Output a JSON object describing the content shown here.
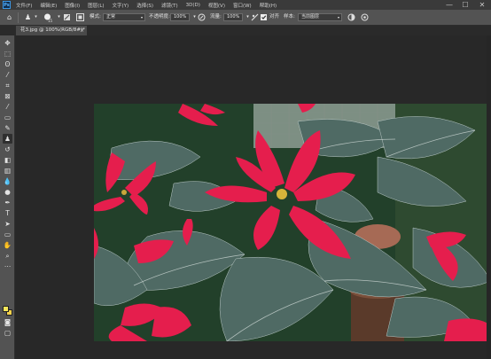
{
  "menubar": {
    "logo": "Ps",
    "items": [
      "文件(F)",
      "编辑(E)",
      "图像(I)",
      "图层(L)",
      "文字(Y)",
      "选择(S)",
      "滤镜(T)",
      "3D(D)",
      "视图(V)",
      "窗口(W)",
      "帮助(H)"
    ],
    "minimize": "—",
    "maximize": "☐",
    "close": "✕"
  },
  "options": {
    "brush_size": "15",
    "mode_label": "模式:",
    "mode_value": "正常",
    "opacity_label": "不透明度:",
    "opacity_value": "100%",
    "flow_label": "流量:",
    "flow_value": "100%",
    "aligned_label": "对齐",
    "sample_label": "样本:",
    "sample_value": "当前图层"
  },
  "document": {
    "tab_title": "花3.jpg @ 100%(RGB/8#)",
    "tab_modified": "*",
    "tab_close": "×"
  },
  "colors": {
    "foreground": "#f7e65a",
    "background": "#f3d24c"
  }
}
